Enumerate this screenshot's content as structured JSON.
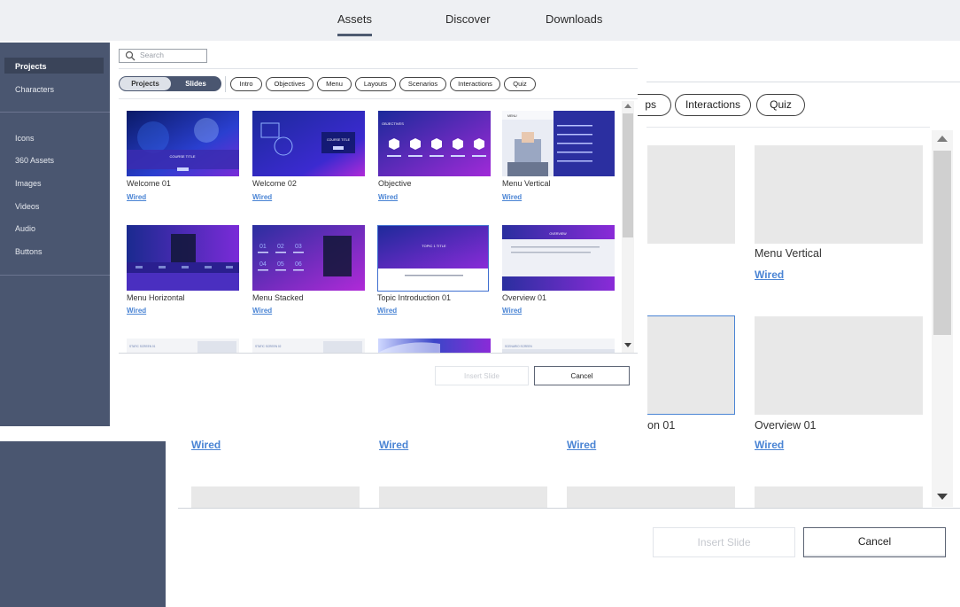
{
  "topnav": {
    "tabs": [
      "Assets",
      "Discover",
      "Downloads"
    ]
  },
  "background_dialog": {
    "pills": [
      "ps",
      "Interactions",
      "Quiz"
    ],
    "cards": [
      {
        "title": "Menu Vertical",
        "link": "Wired"
      },
      {
        "title": "on 01",
        "link": "Wired"
      },
      {
        "title": "Overview 01",
        "link": "Wired"
      }
    ],
    "row2_links": [
      "Wired",
      "Wired",
      "Wired"
    ],
    "insert_label": "Insert Slide",
    "cancel_label": "Cancel"
  },
  "front_dialog": {
    "sidebar": {
      "items": [
        "Projects",
        "Characters",
        "Icons",
        "360 Assets",
        "Images",
        "Videos",
        "Audio",
        "Buttons"
      ]
    },
    "search": {
      "placeholder": "Search"
    },
    "toggle": {
      "projects": "Projects",
      "slides": "Slides"
    },
    "filters": [
      "Intro",
      "Objectives",
      "Menu",
      "Layouts",
      "Scenarios",
      "Interactions",
      "Quiz"
    ],
    "slides": [
      {
        "name": "Welcome 01",
        "link": "Wired",
        "thumb_text": "COURSE TITLE"
      },
      {
        "name": "Welcome 02",
        "link": "Wired",
        "thumb_text": "COURSE TITLE"
      },
      {
        "name": "Objective",
        "link": "Wired",
        "thumb_text": "OBJECTIVES"
      },
      {
        "name": "Menu Vertical",
        "link": "Wired",
        "thumb_text": "MENU"
      },
      {
        "name": "Menu Horizontal",
        "link": "Wired",
        "thumb_text": ""
      },
      {
        "name": "Menu Stacked",
        "link": "Wired",
        "thumb_text": ""
      },
      {
        "name": "Topic Introduction 01",
        "link": "Wired",
        "thumb_text": "TOPIC 1 TITLE"
      },
      {
        "name": "Overview 01",
        "link": "Wired",
        "thumb_text": "OVERVIEW"
      }
    ],
    "menu_stacked_numbers": [
      "01",
      "02",
      "03",
      "04",
      "05",
      "06"
    ],
    "partial_thumbs": [
      "STATIC SCREEN 01",
      "STATIC SCREEN 02",
      "",
      "SCENARIO SCREEN"
    ],
    "insert_label": "Insert Slide",
    "cancel_label": "Cancel"
  }
}
